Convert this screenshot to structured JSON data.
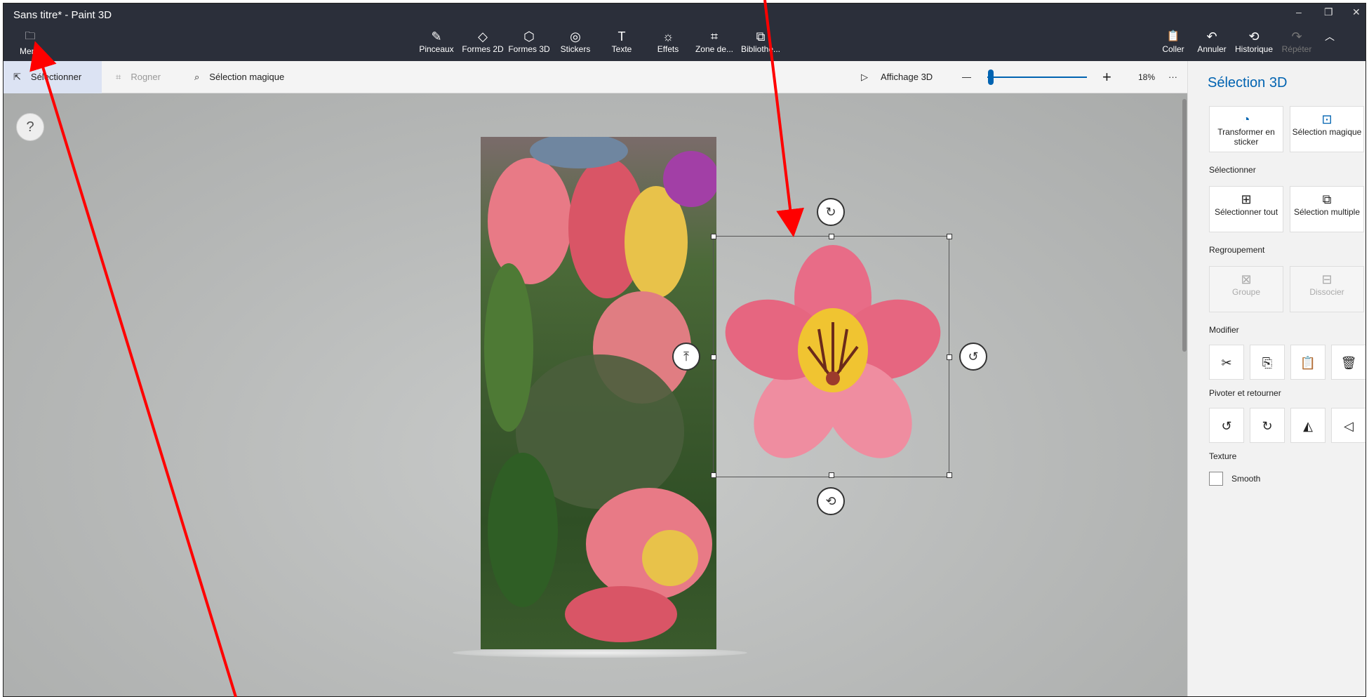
{
  "window": {
    "title": "Sans titre* - Paint 3D",
    "controls": {
      "minimize": "–",
      "restore": "❐",
      "close": "✕"
    }
  },
  "menu": {
    "label": "Menu",
    "icon": "folder-icon"
  },
  "ribbon": [
    {
      "label": "Pinceaux",
      "icon": "brush-icon",
      "glyph": "✎"
    },
    {
      "label": "Formes 2D",
      "icon": "shapes-2d-icon",
      "glyph": "◇"
    },
    {
      "label": "Formes 3D",
      "icon": "cube-icon",
      "glyph": "⬡"
    },
    {
      "label": "Stickers",
      "icon": "sticker-icon",
      "glyph": "◎"
    },
    {
      "label": "Texte",
      "icon": "text-icon",
      "glyph": "T"
    },
    {
      "label": "Effets",
      "icon": "sun-icon",
      "glyph": "☼"
    },
    {
      "label": "Zone de...",
      "icon": "crop-icon",
      "glyph": "⌗"
    },
    {
      "label": "Bibliothè...",
      "icon": "library-icon",
      "glyph": "⧉"
    }
  ],
  "ribbon_right": [
    {
      "label": "Coller",
      "icon": "paste-icon",
      "glyph": "📋",
      "enabled": true
    },
    {
      "label": "Annuler",
      "icon": "undo-icon",
      "glyph": "↶",
      "enabled": true
    },
    {
      "label": "Historique",
      "icon": "history-icon",
      "glyph": "⟲",
      "enabled": true
    },
    {
      "label": "Répéter",
      "icon": "redo-icon",
      "glyph": "↷",
      "enabled": false
    }
  ],
  "toolbar": {
    "select": "Sélectionner",
    "crop": "Rogner",
    "magic": "Sélection magique",
    "view3d": "Affichage 3D",
    "zoom_out": "—",
    "zoom_in": "+",
    "zoom_pct": "18%",
    "zoom_fraction": 0.01,
    "more": "···"
  },
  "canvas": {
    "help": "?"
  },
  "panel": {
    "title": "Sélection 3D",
    "transform_sticker": "Transformer en sticker",
    "magic_select": "Sélection magique",
    "section_select": "Sélectionner",
    "select_all": "Sélectionner tout",
    "multi_select": "Sélection multiple",
    "section_group": "Regroupement",
    "group": "Groupe",
    "ungroup": "Dissocier",
    "section_modify": "Modifier",
    "section_rotate": "Pivoter et retourner",
    "section_texture": "Texture",
    "smooth": "Smooth"
  },
  "colors": {
    "accent": "#0063b1",
    "titlebar": "#2b2f3a",
    "arrow": "#ff0000"
  }
}
